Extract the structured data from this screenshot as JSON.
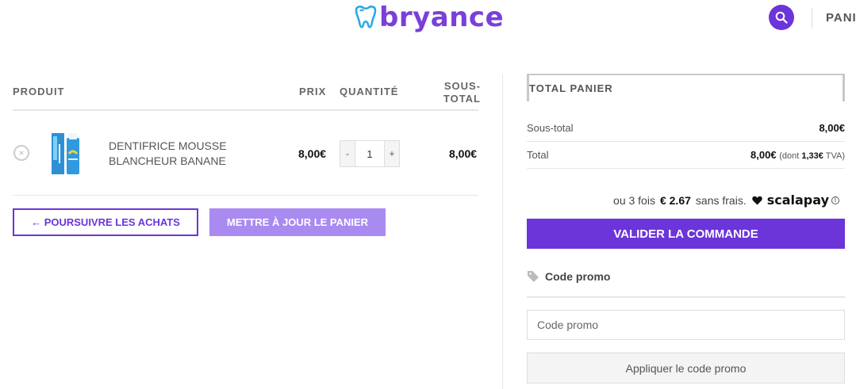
{
  "header": {
    "brand": "bryance",
    "cart_link": "PANI",
    "colors": {
      "brand": "#7a3fd8",
      "tooth": "#2aa8e6"
    }
  },
  "cart": {
    "columns": {
      "product": "PRODUIT",
      "price": "PRIX",
      "quantity": "QUANTITÉ",
      "subtotal": "SOUS-TOTAL"
    },
    "items": [
      {
        "name": "DENTIFRICE MOUSSE BLANCHEUR BANANE",
        "price": "8,00€",
        "quantity": "1",
        "subtotal": "8,00€"
      }
    ],
    "qty_minus": "-",
    "qty_plus": "+",
    "remove_symbol": "×",
    "continue_label": "← POURSUIVRE LES ACHATS",
    "update_label": "METTRE À JOUR LE PANIER"
  },
  "totals": {
    "title": "TOTAL PANIER",
    "subtotal_label": "Sous-total",
    "subtotal_value": "8,00€",
    "total_label": "Total",
    "total_value": "8,00€",
    "tax_prefix": "(dont",
    "tax_amount": "1,33€",
    "tax_suffix": "TVA)",
    "scalapay_prefix": "ou 3 fois",
    "scalapay_amount": "€ 2.67",
    "scalapay_suffix": "sans frais.",
    "scalapay_brand": "scalapay",
    "checkout_label": "VALIDER LA COMMANDE"
  },
  "promo": {
    "heading": "Code promo",
    "placeholder": "Code promo",
    "apply_label": "Appliquer le code promo"
  },
  "colors": {
    "accent": "#6b35d9",
    "accent_light": "#a98af0"
  }
}
